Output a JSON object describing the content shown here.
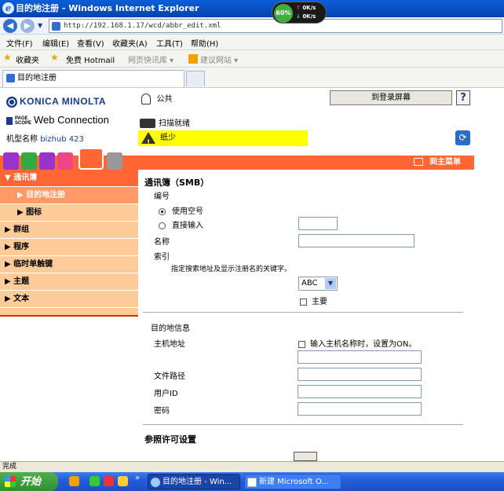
{
  "window": {
    "title": "目的地注册 - Windows Internet Explorer",
    "net_meter": {
      "percent": "60%",
      "up": "0K/s",
      "down": "0K/s"
    }
  },
  "address": {
    "url": "http://192.168.1.17/wcd/abbr_edit.xml"
  },
  "menu": [
    "文件(F)",
    "编辑(E)",
    "查看(V)",
    "收藏夹(A)",
    "工具(T)",
    "帮助(H)"
  ],
  "favorites": {
    "label": "收藏夹",
    "items": [
      "免费 Hotmail",
      "网页快讯库 ▾",
      "建议网站 ▾"
    ]
  },
  "tab": {
    "title": "目的地注册"
  },
  "header": {
    "brand": "KONICA MINOLTA",
    "product": "Web Connection",
    "page_scope": [
      "PAGE",
      "SCOPE"
    ],
    "model_label": "机型名称",
    "model_value": "bizhub 423",
    "user": "公共",
    "login_button": "到登录屏幕",
    "help": "?",
    "scan_status": "扫描就绪",
    "warning": "纸少",
    "to_main": "到主菜单"
  },
  "sidebar": {
    "items": [
      {
        "label": "▼ 通讯簿",
        "type": "main"
      },
      {
        "label": "▶ 目的地注册",
        "type": "sub"
      },
      {
        "label": "▶ 图标",
        "type": "sub2"
      },
      {
        "label": "▶ 群组",
        "type": "item"
      },
      {
        "label": "▶ 程序",
        "type": "item"
      },
      {
        "label": "▶ 临时单触键",
        "type": "item"
      },
      {
        "label": "▶ 主题",
        "type": "item"
      },
      {
        "label": "▶ 文本",
        "type": "item"
      }
    ]
  },
  "form": {
    "title": "通讯簿（SMB）",
    "number_label": "编号",
    "opt_use_free": "使用空号",
    "opt_direct": "直接输入",
    "name_label": "名称",
    "index_label": "索引",
    "index_hint": "指定搜索地址及显示注册名的关键字。",
    "index_value": "ABC",
    "primary_label": "主要",
    "dest_info": "目的地信息",
    "host_label": "主机地址",
    "host_hint": "输入主机名称时，设置为ON。",
    "path_label": "文件路径",
    "user_label": "用户ID",
    "password_label": "密码",
    "ref_title": "参照许可设置"
  },
  "statusbar": {
    "text": "完成"
  },
  "taskbar": {
    "start": "开始",
    "items": [
      {
        "label": "目的地注册 - Win...",
        "active": true
      },
      {
        "label": "新建 Microsoft O...",
        "active": false
      }
    ]
  }
}
